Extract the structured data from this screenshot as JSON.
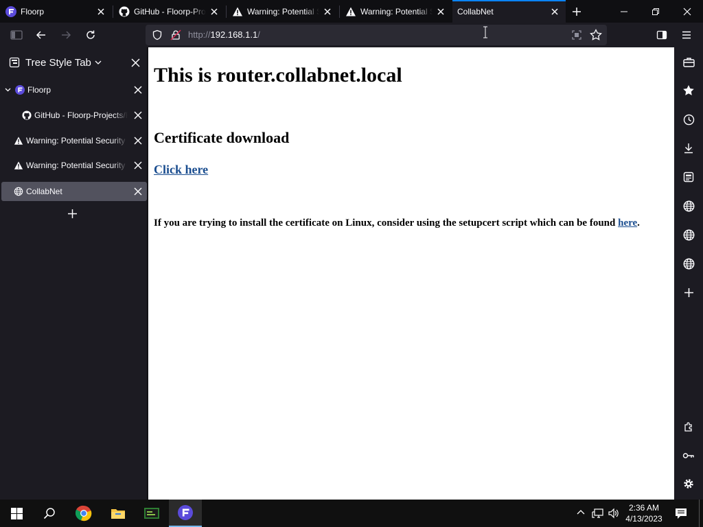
{
  "tabs": [
    {
      "title": "Floorp",
      "icon": "floorp-logo-icon"
    },
    {
      "title": "GitHub - Floorp-Projects/Floorp",
      "icon": "github-icon"
    },
    {
      "title": "Warning: Potential Security Risk Ahead",
      "icon": "warning-icon"
    },
    {
      "title": "Warning: Potential Security Risk Ahead",
      "icon": "warning-icon"
    },
    {
      "title": "CollabNet",
      "icon": "none",
      "active": true
    }
  ],
  "url": {
    "prefix": "http://",
    "host": "192.168.1.1",
    "path": "/"
  },
  "sidebar": {
    "title": "Tree Style Tab",
    "items": [
      {
        "label": "Floorp",
        "icon": "floorp-logo-icon"
      },
      {
        "label": "GitHub - Floorp-Projects/Floorp",
        "icon": "github-icon"
      },
      {
        "label": "Warning: Potential Security Risk Ahead",
        "icon": "warning-icon"
      },
      {
        "label": "Warning: Potential Security Risk Ahead",
        "icon": "warning-icon"
      },
      {
        "label": "CollabNet",
        "icon": "globe-icon",
        "active": true
      }
    ]
  },
  "page": {
    "heading": "This is router.collabnet.local",
    "subheading": "Certificate download",
    "download_link": "Click here",
    "linux_note": "If you are trying to install the certificate on Linux, consider using the setupcert script which can be found",
    "linux_link": "here",
    "linux_end": "."
  },
  "clock": {
    "time": "2:36 AM",
    "date": "4/13/2023"
  },
  "colors": {
    "accent": "#0a84ff",
    "link": "#1a4d8f",
    "chrome_bg": "#1c1b22",
    "tabstrip_bg": "#0f0f12"
  }
}
